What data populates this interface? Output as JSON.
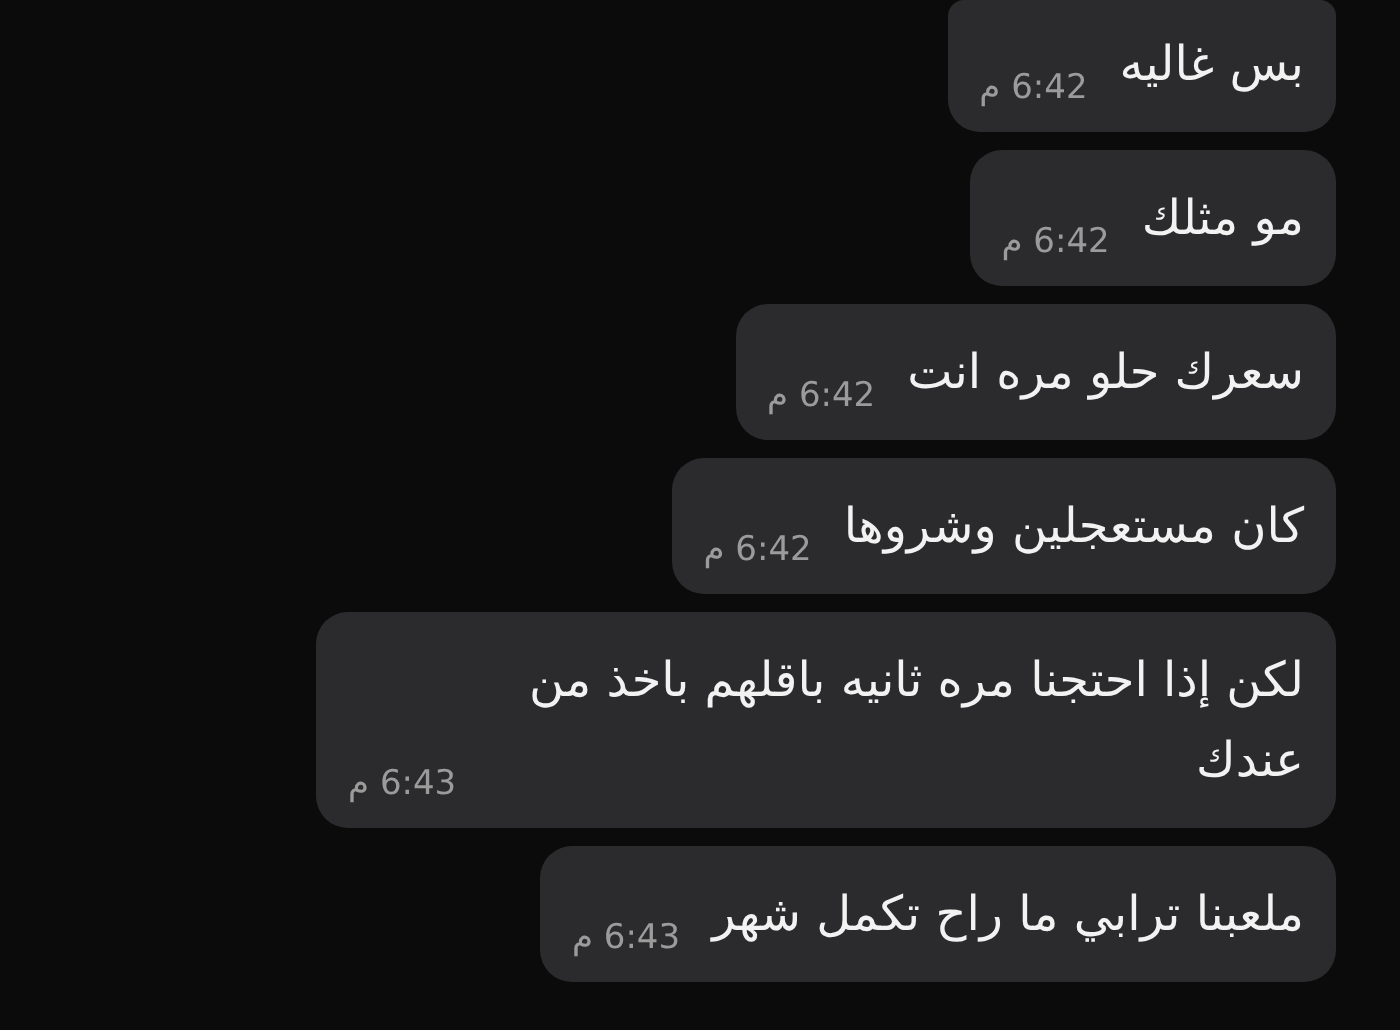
{
  "messages": [
    {
      "text": "بس غاليه",
      "time": "6:42 م"
    },
    {
      "text": "مو مثلك",
      "time": "6:42 م"
    },
    {
      "text": "سعرك حلو مره انت",
      "time": "6:42 م"
    },
    {
      "text": "كان مستعجلين وشروها",
      "time": "6:42 م"
    },
    {
      "text": "لكن إذا احتجنا مره ثانيه باقلهم باخذ من عندك",
      "time": "6:43 م"
    },
    {
      "text": "ملعبنا ترابي ما راح تكمل شهر",
      "time": "6:43 م"
    }
  ]
}
